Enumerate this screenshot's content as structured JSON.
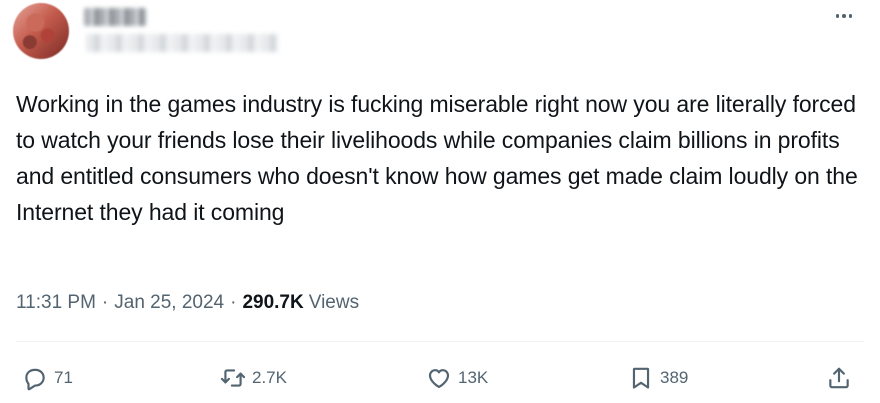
{
  "tweet": {
    "text": "Working in the games industry is fucking miserable right now you are literally forced to watch your friends lose their livelihoods while companies claim billions in profits and entitled consumers who doesn't know how games get made claim loudly on the Internet they had it coming",
    "time": "11:31 PM",
    "date": "Jan 25, 2024",
    "dot": "·",
    "views_count": "290.7K",
    "views_label": "Views"
  },
  "actions": {
    "replies": "71",
    "retweets": "2.7K",
    "likes": "13K",
    "bookmarks": "389"
  },
  "icons": {
    "more": "more-horizontal-icon",
    "reply": "reply-bubble-icon",
    "retweet": "retweet-arrows-icon",
    "like": "heart-icon",
    "bookmark": "bookmark-icon",
    "share": "share-upload-icon"
  }
}
